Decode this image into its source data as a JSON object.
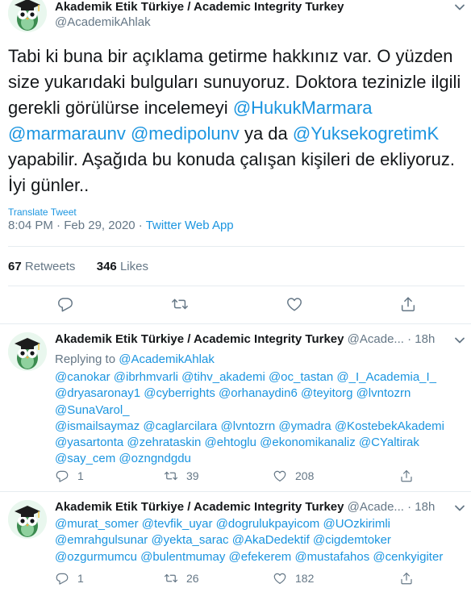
{
  "main_tweet": {
    "display_name": "Akademik Etik Türkiye / Academic Integrity Turkey",
    "handle": "@AcademikAhlak",
    "text_plain_1": "Tabi ki buna bir açıklama getirme hakkınız var. O yüzden size yukarıdaki bulguları sunuyoruz. Doktora tezinizle ilgili gerekli görülürse incelemeyi",
    "mention_1": "@HukukMarmara",
    "mention_2": "@marmaraunv",
    "mention_3": "@medipolunv",
    "text_plain_2": "ya da",
    "mention_4": "@YuksekogretimK",
    "text_plain_3": "yapabilir. Aşağıda bu konuda çalışan kişileri de ekliyoruz. İyi günler..",
    "translate_label": "Translate Tweet",
    "time": "8:04 PM",
    "date": "Feb 29, 2020",
    "separator": "·",
    "source": "Twitter Web App",
    "retweets_count": "67",
    "retweets_label": "Retweets",
    "likes_count": "346",
    "likes_label": "Likes"
  },
  "replies": [
    {
      "display_name": "Akademik Etik Türkiye / Academic Integrity Turkey",
      "handle_trunc": "@Acade...",
      "separator": "·",
      "age": "18h",
      "replying_to_label": "Replying to",
      "replying_to_handle": "@AcademikAhlak",
      "lines": [
        "@canokar @ibrhmvarli  @tihv_akademi @oc_tastan @_I_Academia_I_",
        "@dryasaronay1 @cyberrights @orhanaydin6 @teyitorg @lvntozrn",
        "@SunaVarol_",
        "@ismailsaymaz @caglarcilara @lvntozrn @ymadra @KostebekAkademi",
        "@yasartonta @zehrataskin @ehtoglu @ekonomikanaliz @CYaltirak",
        "@say_cem @ozngndgdu"
      ],
      "reply_count": "1",
      "retweet_count": "39",
      "like_count": "208"
    },
    {
      "display_name": "Akademik Etik Türkiye / Academic Integrity Turkey",
      "handle_trunc": "@Acade...",
      "separator": "·",
      "age": "18h",
      "lines": [
        "@murat_somer @tevfik_uyar @dogrulukpayicom @UOzkirimli",
        "@emrahgulsunar @yekta_sarac @AkaDedektif @cigdemtoker",
        "@ozgurmumcu @bulentmumay @efekerem @mustafahos @cenkyigiter"
      ],
      "reply_count": "1",
      "retweet_count": "26",
      "like_count": "182"
    }
  ],
  "colors": {
    "link": "#1b95e0",
    "secondary_text": "#657786",
    "primary_text": "#14171a",
    "divider": "#e6ecf0"
  },
  "icons": [
    "owl-avatar-icon",
    "chevron-down-icon",
    "reply-icon",
    "retweet-icon",
    "like-icon",
    "share-icon"
  ]
}
